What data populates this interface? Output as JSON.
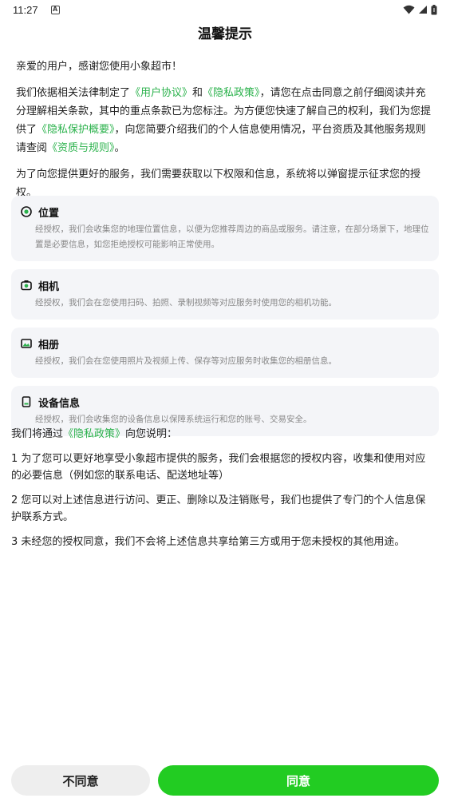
{
  "status_bar": {
    "time": "11:27",
    "notification_glyph": "A",
    "icons": [
      "wifi-icon",
      "signal-icon",
      "battery-icon"
    ]
  },
  "dialog": {
    "title": "温馨提示",
    "greeting": "亲爱的用户，感谢您使用小象超市！",
    "p1": {
      "t1": "我们依据相关法律制定了",
      "link1": "《用户协议》",
      "t2": "和",
      "link2": "《隐私政策》",
      "t3": "，请您在点击同意之前仔细阅读并充分理解相关条款，其中的重点条款已为您标注。为方便您快速了解自己的权利，我们为您提供了",
      "link3": "《隐私保护概要》",
      "t4": "，向您简要介绍我们的个人信息使用情况，平台资质及其他服务规则请查阅",
      "link4": "《资质与规则》",
      "t5": "。"
    },
    "p2": "为了向您提供更好的服务，我们需要获取以下权限和信息，系统将以弹窗提示征求您的授权。",
    "permissions": [
      {
        "title": "位置",
        "desc": "经授权，我们会收集您的地理位置信息，以便为您推荐周边的商品或服务。请注意，在部分场景下，地理位置是必要信息，如您拒绝授权可能影响正常使用。",
        "icon": "location-icon"
      },
      {
        "title": "相机",
        "desc": "经授权，我们会在您使用扫码、拍照、录制视频等对应服务时使用您的相机功能。",
        "icon": "camera-icon"
      },
      {
        "title": "相册",
        "desc": "经授权，我们会在您使用照片及视频上传、保存等对应服务时收集您的相册信息。",
        "icon": "album-icon"
      },
      {
        "title": "设备信息",
        "desc": "经授权，我们会收集您的设备信息以保障系统运行和您的账号、交易安全。",
        "icon": "device-icon"
      }
    ],
    "p3": {
      "t1": "我们将通过",
      "link": "《隐私政策》",
      "t2": "向您说明："
    },
    "items": [
      "1 为了您可以更好地享受小象超市提供的服务，我们会根据您的授权内容，收集和使用对应的必要信息（例如您的联系电话、配送地址等）",
      "2 您可以对上述信息进行访问、更正、删除以及注销账号，我们也提供了专门的个人信息保护联系方式。",
      "3 未经您的授权同意，我们不会将上述信息共享给第三方或用于您未授权的其他用途。"
    ]
  },
  "buttons": {
    "disagree": "不同意",
    "agree": "同意"
  },
  "colors": {
    "link": "#2bb24c",
    "agree_button": "#22cc22",
    "card_background": "#f4f5f8"
  }
}
